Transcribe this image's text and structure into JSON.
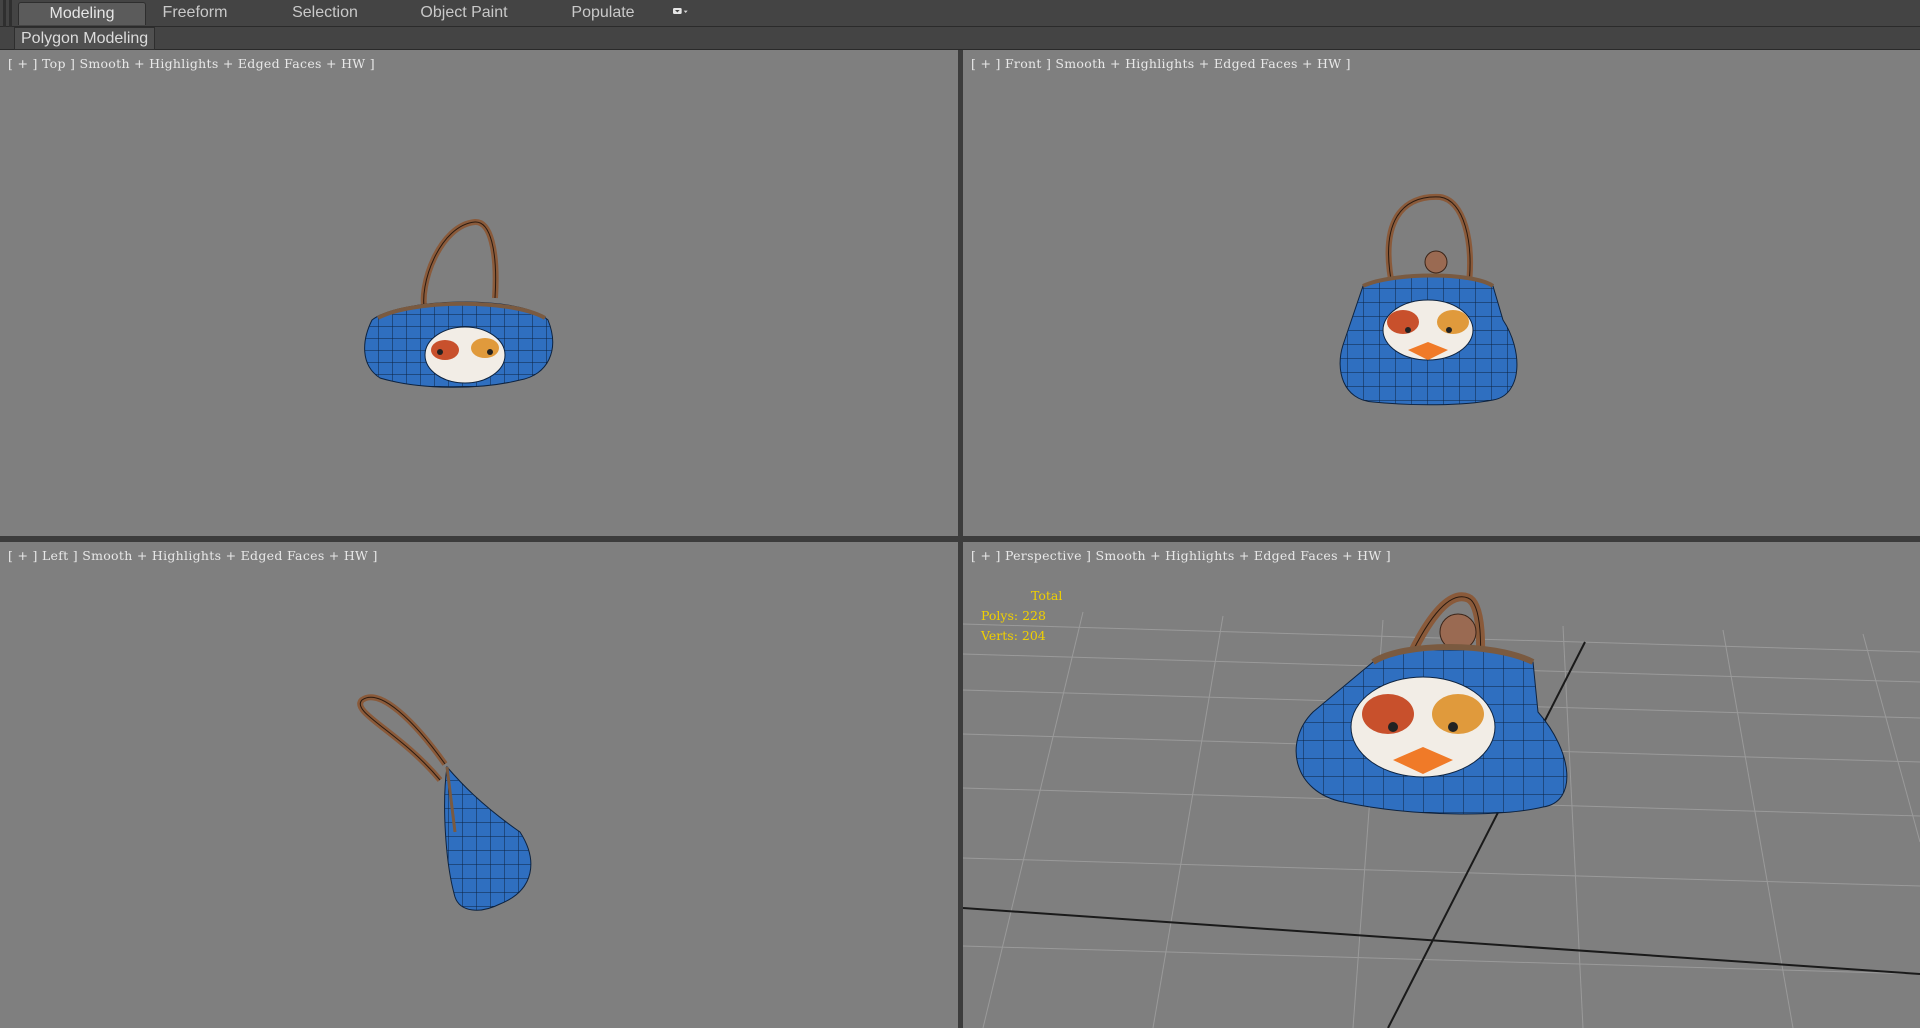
{
  "ribbon": {
    "tabs": [
      {
        "label": "Modeling",
        "active": true
      },
      {
        "label": "Freeform",
        "active": false
      },
      {
        "label": "Selection",
        "active": false
      },
      {
        "label": "Object Paint",
        "active": false
      },
      {
        "label": "Populate",
        "active": false
      }
    ],
    "options_icon": "dropdown-menu-icon",
    "panel_label": "Polygon Modeling"
  },
  "viewports": {
    "top": {
      "label": "[ + ] Top ] Smooth + Highlights + Edged Faces + HW ]"
    },
    "front": {
      "label": "[ + ] Front ] Smooth + Highlights + Edged Faces + HW ]"
    },
    "left": {
      "label": "[ + ] Left ] Smooth + Highlights + Edged Faces + HW ]"
    },
    "perspective": {
      "label": "[ + ] Perspective ] Smooth + Highlights + Edged Faces + HW ]"
    }
  },
  "stats": {
    "title": "Total",
    "polys": "Polys: 228",
    "verts": "Verts: 204"
  },
  "colors": {
    "viewport_bg": "#7f7f7f",
    "bag_blue": "#2f6fc0",
    "handle_brown": "#8a5a3a",
    "stats_yellow": "#f0d000"
  }
}
